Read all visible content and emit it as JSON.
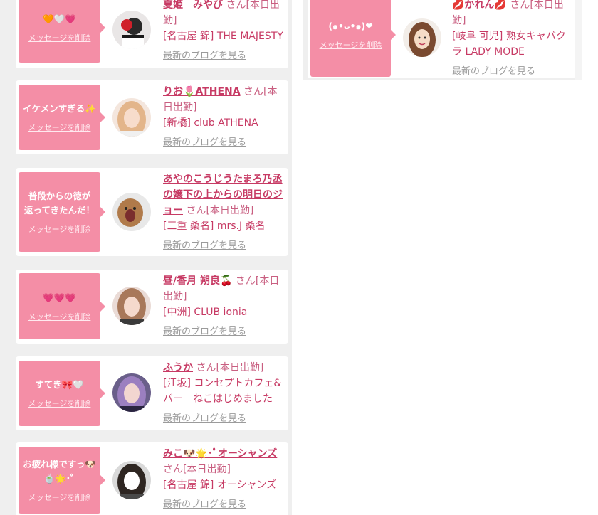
{
  "colors": {
    "accent_pink": "#f48ea6",
    "name_color": "#c73a64",
    "blog_link": "#9b9b9b",
    "page_bg": "#efefef"
  },
  "messages": [
    {
      "text": "🧡🤍💗",
      "delete_label": "メッセージを削除",
      "name": "夏姫　みやび",
      "honorific": "さん",
      "status": "[本日出勤]",
      "shop": "[名古屋 錦] THE MAJESTY",
      "blog_label": "最新のブログを見る",
      "avatar_icon": "avatar-photo-red-flower"
    },
    {
      "text": "イケメンすぎる✨",
      "delete_label": "メッセージを削除",
      "name": "りお🌷ATHENA",
      "honorific": "さん",
      "status": "[本日出勤]",
      "shop": "[新橋] club ATHENA",
      "blog_label": "最新のブログを見る",
      "avatar_icon": "avatar-photo-blonde"
    },
    {
      "text": "普段からの徳が返ってきたんだ！",
      "delete_label": "メッセージを削除",
      "name": "あやのこうじうたまろ乃丞の嬢下の上からの明日のジョー",
      "honorific": "さん",
      "status": "[本日出勤]",
      "shop": "[三重 桑名] mrs.J 桑名",
      "blog_label": "最新のブログを見る",
      "avatar_icon": "avatar-photo-lion"
    },
    {
      "text": "💗💗💗",
      "delete_label": "メッセージを削除",
      "name": "昼/香月 朔良🍒",
      "honorific": "さん",
      "status": "[本日出勤]",
      "shop": "[中洲] CLUB ionia",
      "blog_label": "最新のブログを見る",
      "avatar_icon": "avatar-photo-portrait"
    },
    {
      "text": "すてき🎀🤍",
      "delete_label": "メッセージを削除",
      "name": "ふうか",
      "honorific": "さん",
      "status": "[本日出勤]",
      "shop": "[江坂] コンセプトカフェ&バー　ねこはじめました",
      "blog_label": "最新のブログを見る",
      "avatar_icon": "avatar-photo-purple-hair"
    },
    {
      "text": "お疲れ様ですっ🐶🍵🌟･ﾟ",
      "delete_label": "メッセージを削除",
      "name": "みこ🐶🌟･ﾟオーシャンズ",
      "honorific": "さん",
      "status": "[本日出勤]",
      "shop": "[名古屋 錦] オーシャンズ",
      "blog_label": "最新のブログを見る",
      "avatar_icon": "avatar-photo-dark-hair"
    },
    {
      "text": "(๑•ᴗ•๑)❤",
      "delete_label": "メッセージを削除",
      "name": "💋かれん💋",
      "honorific": "さん",
      "status": "[本日出勤]",
      "shop": "[岐阜 可児] 熟女キャバクラ LADY MODE",
      "blog_label": "最新のブログを見る",
      "avatar_icon": "avatar-illustration-woman"
    }
  ]
}
